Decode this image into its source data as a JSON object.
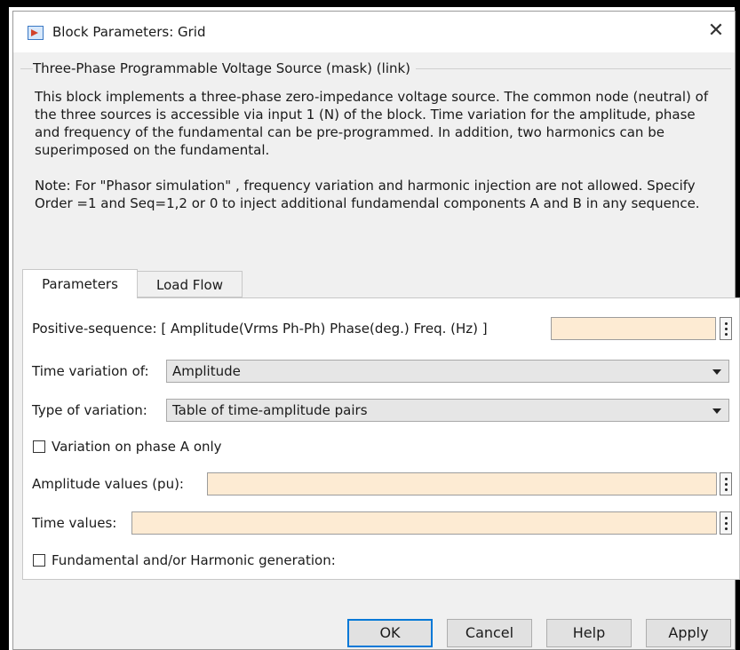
{
  "window": {
    "title": "Block Parameters: Grid",
    "close_glyph": "✕"
  },
  "mask": {
    "group_title": "Three-Phase Programmable Voltage Source (mask) (link)",
    "description": "This block implements a three-phase zero-impedance voltage source. The common node (neutral) of the three sources is accessible via input 1 (N) of the block. Time variation for the amplitude, phase and frequency of the fundamental can be pre-programmed. In addition, two harmonics can be superimposed on the fundamental.",
    "note": "Note: For \"Phasor simulation\" , frequency variation and harmonic injection are not allowed. Specify Order =1 and Seq=1,2 or 0 to inject additional fundamendal components A and B in any sequence."
  },
  "tabs": [
    {
      "label": "Parameters",
      "active": true
    },
    {
      "label": "Load Flow",
      "active": false
    }
  ],
  "params": {
    "positive_sequence": {
      "label": "Positive-sequence: [ Amplitude(Vrms Ph-Ph)  Phase(deg.)   Freq. (Hz) ]",
      "value": ""
    },
    "time_variation": {
      "label": "Time variation of:",
      "value": "Amplitude"
    },
    "type_variation": {
      "label": "Type of variation:",
      "value": "Table of time-amplitude pairs"
    },
    "phase_a_only": {
      "label": "Variation on phase A only",
      "checked": false
    },
    "amplitude_values": {
      "label": "Amplitude values (pu):",
      "value": ""
    },
    "time_values": {
      "label": "Time values:",
      "value": ""
    },
    "harmonic_generation": {
      "label": "Fundamental and/or Harmonic generation:",
      "checked": false
    }
  },
  "buttons": {
    "ok": "OK",
    "cancel": "Cancel",
    "help": "Help",
    "apply": "Apply"
  },
  "colors": {
    "edit_background": "#fdebd3",
    "default_button_border": "#0078d7"
  }
}
